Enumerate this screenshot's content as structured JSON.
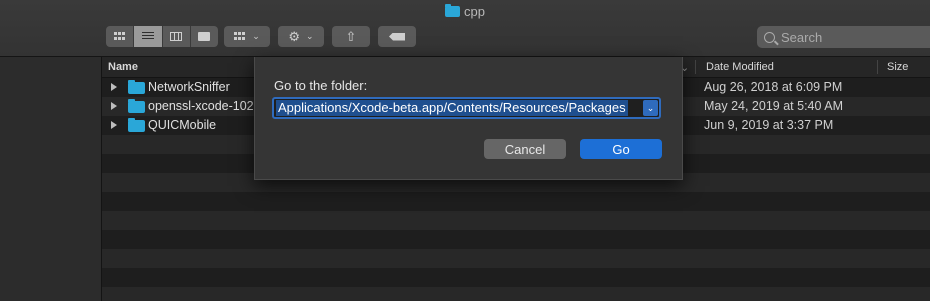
{
  "window": {
    "title": "cpp"
  },
  "toolbar": {
    "views": [
      "icon-view",
      "list-view",
      "column-view",
      "gallery-view"
    ],
    "active_view": "list-view",
    "search_placeholder": "Search"
  },
  "file_list": {
    "columns": {
      "name": "Name",
      "date_modified": "Date Modified",
      "size": "Size"
    },
    "rows": [
      {
        "name": "NetworkSniffer",
        "date": "Aug 26, 2018 at 6:09 PM"
      },
      {
        "name": "openssl-xcode-102",
        "date": "May 24, 2019 at 5:40 AM"
      },
      {
        "name": "QUICMobile",
        "date": "Jun 9, 2019 at 3:37 PM"
      }
    ]
  },
  "dialog": {
    "label": "Go to the folder:",
    "path": "Applications/Xcode-beta.app/Contents/Resources/Packages",
    "cancel_label": "Cancel",
    "go_label": "Go"
  },
  "colors": {
    "accent": "#1d6fd6",
    "folder": "#2aa7d8"
  }
}
